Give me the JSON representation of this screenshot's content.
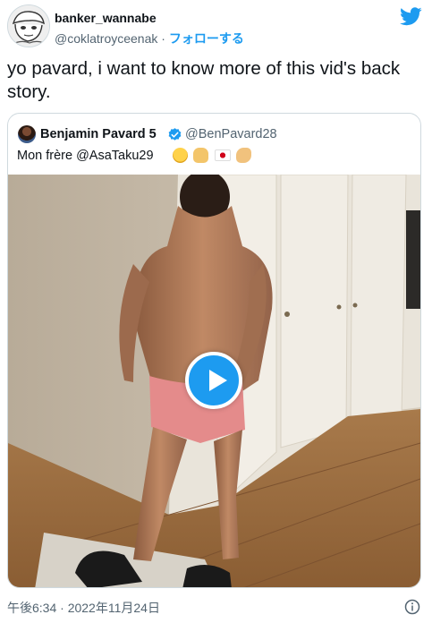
{
  "author": {
    "display_name": "banker_wannabe",
    "handle": "@coklatroyceenak",
    "separator": "·",
    "follow_label": "フォローする",
    "avatar_icon": "cartoon-avatar-icon"
  },
  "tweet": {
    "text": "yo pavard, i want to know more of this vid's back story."
  },
  "quoted_tweet": {
    "display_name": "Benjamin Pavard 5",
    "handle": "@BenPavard28",
    "verified_icon": "verified-badge-icon",
    "text": "Mon frère @AsaTaku29",
    "emoji": [
      "face-with-tears-of-joy",
      "clapping-hands",
      "flag-japan",
      "flexed-biceps"
    ],
    "media": {
      "type": "video",
      "play_icon": "play-icon"
    }
  },
  "footer": {
    "timestamp": "午後6:34 · 2022年11月24日",
    "info_icon": "info-icon"
  },
  "colors": {
    "brand": "#1d9bf0",
    "text_primary": "#0f1419",
    "text_secondary": "#536471",
    "border": "#cfd9de"
  }
}
